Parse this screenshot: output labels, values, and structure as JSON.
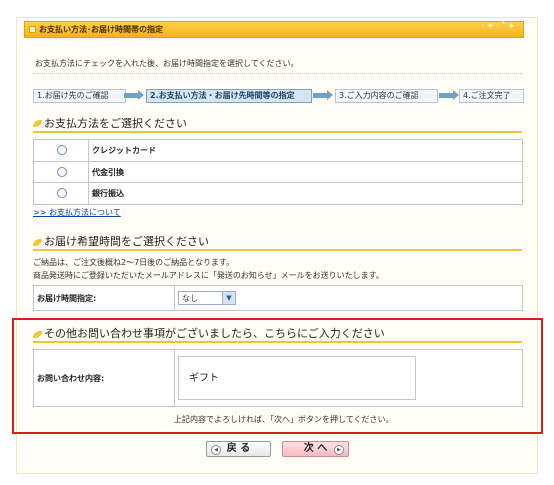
{
  "header": {
    "title": "お支払い方法･お届け時間帯の指定"
  },
  "intro": "お支払方法にチェックを入れた後、お届け時間指定を選択してください。",
  "steps": [
    {
      "label": "1.お届け先のご確認"
    },
    {
      "label": "2.お支払い方法・お届け先時間等の指定"
    },
    {
      "label": "3.ご入力内容のご確認"
    },
    {
      "label": "4.ご注文完了"
    }
  ],
  "payment": {
    "title": "お支払方法をご選択ください",
    "options": [
      {
        "label": "クレジットカード"
      },
      {
        "label": "代金引換"
      },
      {
        "label": "銀行振込"
      }
    ],
    "about_link": ">> お支払方法について"
  },
  "delivery": {
    "title": "お届け希望時間をご選択ください",
    "note1": "ご納品は、ご注文後概ね2～7日後のご納品となります。",
    "note2": "商品発送時にご登録いただいたメールアドレスに「発送のお知らせ」メールをお送りいたします。",
    "field_label": "お届け時間指定:",
    "selected": "なし"
  },
  "inquiry": {
    "title": "その他お問い合わせ事項がございましたら、こちらにご入力ください",
    "field_label": "お問い合わせ内容:",
    "value": "ギフト",
    "note": "上記内容でよろしければ、「次へ」ボタンを押してください。"
  },
  "buttons": {
    "back": "戻 る",
    "next": "次 へ"
  },
  "colors": {
    "accent": "#f4c238",
    "highlight": "#d3221c",
    "next_button": "#f7b9c2"
  }
}
